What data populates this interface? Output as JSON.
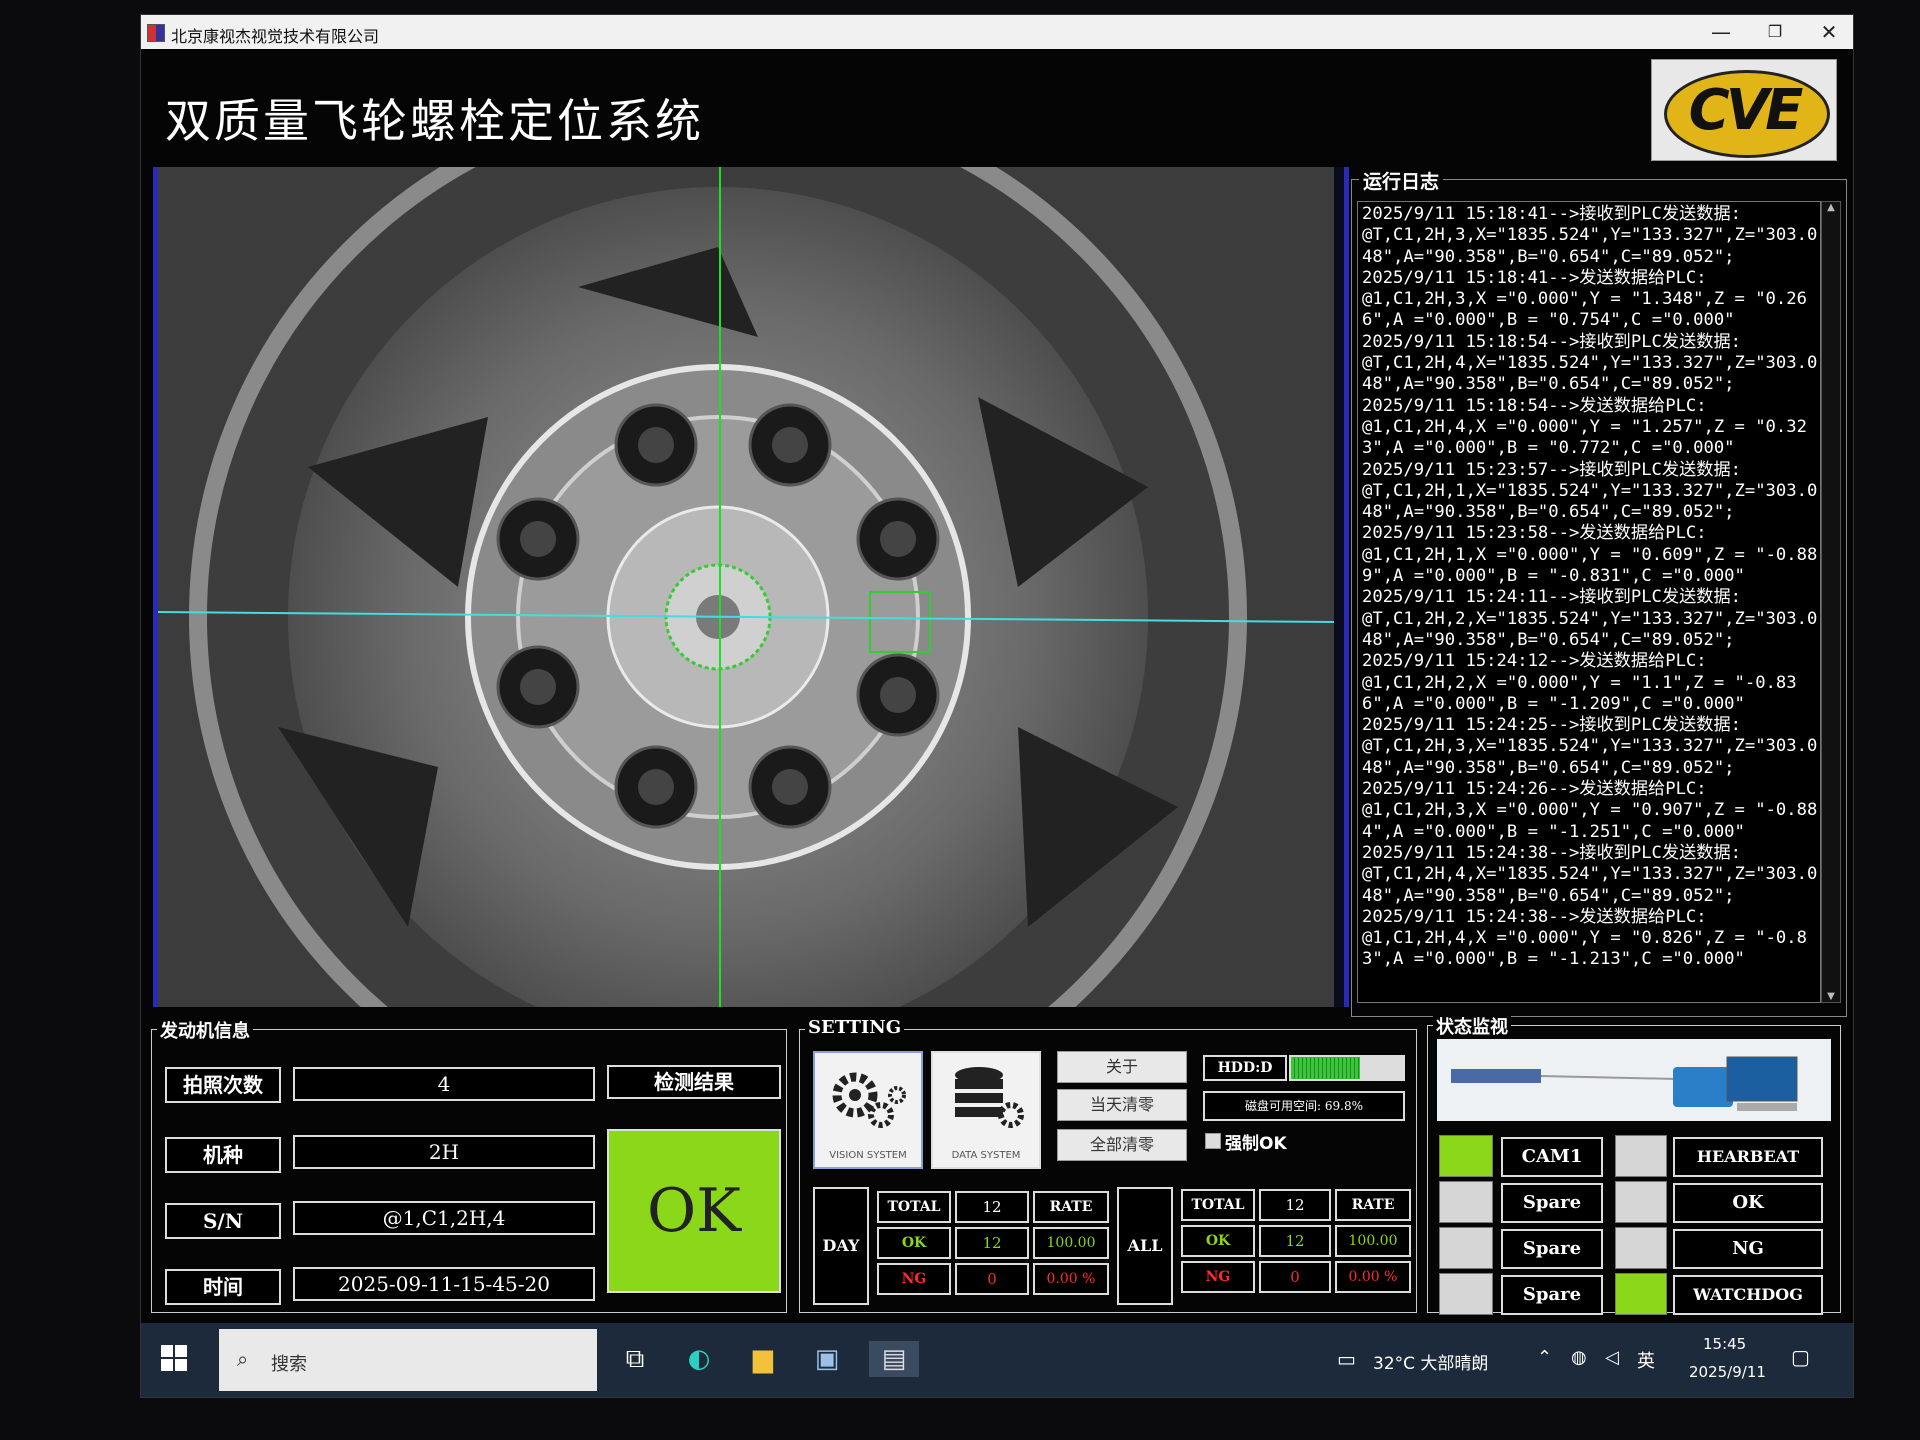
{
  "window": {
    "title": "北京康视杰视觉技术有限公司",
    "min_glyph": "—",
    "max_glyph": "❐",
    "close_glyph": "✕"
  },
  "app": {
    "title": "双质量飞轮螺栓定位系统",
    "logo_text": "CVE"
  },
  "log": {
    "title": "运行日志",
    "text": "2025/9/11 15:18:41-->接收到PLC发送数据:\n@T,C1,2H,3,X=\"1835.524\",Y=\"133.327\",Z=\"303.048\",A=\"90.358\",B=\"0.654\",C=\"89.052\";\n2025/9/11 15:18:41-->发送数据给PLC:\n@1,C1,2H,3,X =\"0.000\",Y = \"1.348\",Z = \"0.266\",A =\"0.000\",B = \"0.754\",C =\"0.000\"\n2025/9/11 15:18:54-->接收到PLC发送数据:\n@T,C1,2H,4,X=\"1835.524\",Y=\"133.327\",Z=\"303.048\",A=\"90.358\",B=\"0.654\",C=\"89.052\";\n2025/9/11 15:18:54-->发送数据给PLC:\n@1,C1,2H,4,X =\"0.000\",Y = \"1.257\",Z = \"0.323\",A =\"0.000\",B = \"0.772\",C =\"0.000\"\n2025/9/11 15:23:57-->接收到PLC发送数据:\n@T,C1,2H,1,X=\"1835.524\",Y=\"133.327\",Z=\"303.048\",A=\"90.358\",B=\"0.654\",C=\"89.052\";\n2025/9/11 15:23:58-->发送数据给PLC:\n@1,C1,2H,1,X =\"0.000\",Y = \"0.609\",Z = \"-0.889\",A =\"0.000\",B = \"-0.831\",C =\"0.000\"\n2025/9/11 15:24:11-->接收到PLC发送数据:\n@T,C1,2H,2,X=\"1835.524\",Y=\"133.327\",Z=\"303.048\",A=\"90.358\",B=\"0.654\",C=\"89.052\";\n2025/9/11 15:24:12-->发送数据给PLC:\n@1,C1,2H,2,X =\"0.000\",Y = \"1.1\",Z = \"-0.836\",A =\"0.000\",B = \"-1.209\",C =\"0.000\"\n2025/9/11 15:24:25-->接收到PLC发送数据:\n@T,C1,2H,3,X=\"1835.524\",Y=\"133.327\",Z=\"303.048\",A=\"90.358\",B=\"0.654\",C=\"89.052\";\n2025/9/11 15:24:26-->发送数据给PLC:\n@1,C1,2H,3,X =\"0.000\",Y = \"0.907\",Z = \"-0.884\",A =\"0.000\",B = \"-1.251\",C =\"0.000\"\n2025/9/11 15:24:38-->接收到PLC发送数据:\n@T,C1,2H,4,X=\"1835.524\",Y=\"133.327\",Z=\"303.048\",A=\"90.358\",B=\"0.654\",C=\"89.052\";\n2025/9/11 15:24:38-->发送数据给PLC:\n@1,C1,2H,4,X =\"0.000\",Y = \"0.826\",Z = \"-0.83\",A =\"0.000\",B = \"-1.213\",C =\"0.000\""
  },
  "engine": {
    "title": "发动机信息",
    "rows": [
      {
        "label": "拍照次数",
        "value": "4"
      },
      {
        "label": "机种",
        "value": "2H"
      },
      {
        "label": "S/N",
        "value": "@1,C1,2H,4"
      },
      {
        "label": "时间",
        "value": "2025-09-11-15-45-20"
      }
    ],
    "result_label": "检测结果",
    "result_value": "OK",
    "result_color": "#8bd71a"
  },
  "setting": {
    "title": "SETTING",
    "vision_caption": "VISION SYSTEM",
    "data_caption": "DATA SYSTEM",
    "about": "关于",
    "clear_today": "当天清零",
    "clear_all": "全部清零",
    "hdd_label": "HDD:D",
    "hdd_usage_fraction": 0.62,
    "disk_text": "磁盘可用空间: 69.8%",
    "force_ok": "强制OK",
    "day": {
      "label": "DAY",
      "total_label": "TOTAL",
      "total": "12",
      "rate_label": "RATE",
      "ok_label": "OK",
      "ok": "12",
      "rate": "100.00",
      "ng_label": "NG",
      "ng": "0",
      "ng_rate": "0.00 %"
    },
    "all": {
      "label": "ALL",
      "total_label": "TOTAL",
      "total": "12",
      "rate_label": "RATE",
      "ok_label": "OK",
      "ok": "12",
      "rate": "100.00",
      "ng_label": "NG",
      "ng": "0",
      "ng_rate": "0.00 %"
    }
  },
  "status": {
    "title": "状态监视",
    "left": [
      {
        "label": "CAM1",
        "active": true
      },
      {
        "label": "Spare",
        "active": false
      },
      {
        "label": "Spare",
        "active": false
      },
      {
        "label": "Spare",
        "active": false
      }
    ],
    "right": [
      {
        "label": "HEARBEAT",
        "active": false
      },
      {
        "label": "OK",
        "active": false
      },
      {
        "label": "NG",
        "active": false
      },
      {
        "label": "WATCHDOG",
        "active": true
      }
    ],
    "active_color": "#8bd71a",
    "inactive_color": "#d6d6d6"
  },
  "taskbar": {
    "search_placeholder": "搜索",
    "weather": "32°C 大部晴朗",
    "ime": "英",
    "time": "15:45",
    "date": "2025/9/11"
  }
}
